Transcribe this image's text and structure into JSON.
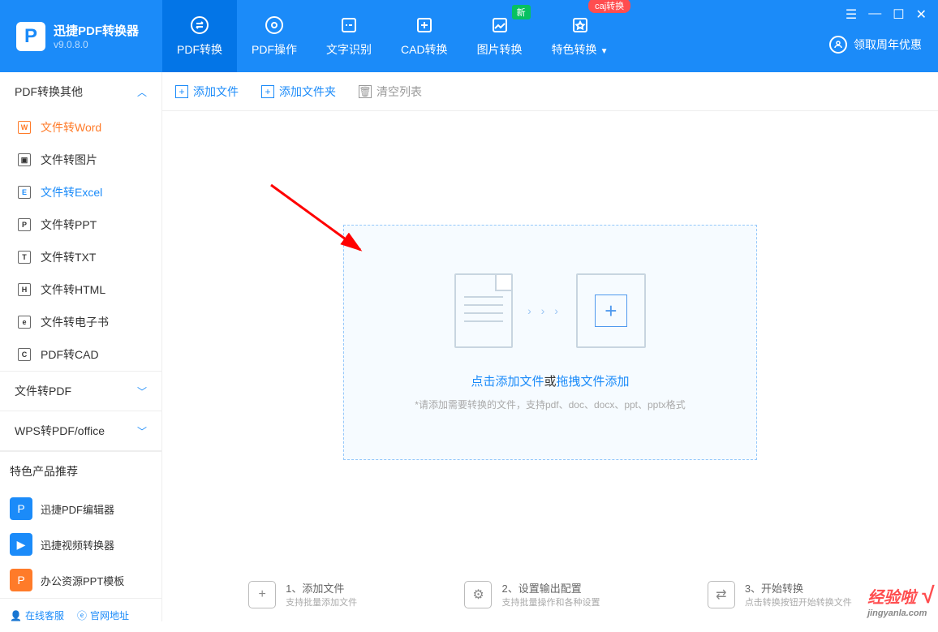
{
  "app": {
    "name": "迅捷PDF转换器",
    "version": "v9.0.8.0"
  },
  "nav": [
    {
      "label": "PDF转换"
    },
    {
      "label": "PDF操作"
    },
    {
      "label": "文字识别"
    },
    {
      "label": "CAD转换"
    },
    {
      "label": "图片转换",
      "badge": "新"
    },
    {
      "label": "特色转换",
      "badge_red": "caj转换"
    }
  ],
  "login": {
    "label": "领取周年优惠"
  },
  "sidebar": {
    "group1": {
      "title": "PDF转换其他",
      "items": [
        {
          "label": "文件转Word",
          "ic": "W"
        },
        {
          "label": "文件转图片",
          "ic": "▣"
        },
        {
          "label": "文件转Excel",
          "ic": "E"
        },
        {
          "label": "文件转PPT",
          "ic": "P"
        },
        {
          "label": "文件转TXT",
          "ic": "T"
        },
        {
          "label": "文件转HTML",
          "ic": "H"
        },
        {
          "label": "文件转电子书",
          "ic": "e"
        },
        {
          "label": "PDF转CAD",
          "ic": "C"
        }
      ]
    },
    "group2": {
      "title": "文件转PDF"
    },
    "group3": {
      "title": "WPS转PDF/office"
    },
    "recommend": {
      "title": "特色产品推荐",
      "items": [
        {
          "label": "迅捷PDF编辑器"
        },
        {
          "label": "迅捷视频转换器"
        },
        {
          "label": "办公资源PPT模板"
        }
      ]
    },
    "footer": {
      "chat": "在线客服",
      "web": "官网地址"
    }
  },
  "toolbar": {
    "add_file": "添加文件",
    "add_folder": "添加文件夹",
    "clear": "清空列表"
  },
  "drop": {
    "link1": "点击添加文件",
    "or": "或",
    "link2": "拖拽文件添加",
    "hint": "*请添加需要转换的文件，支持pdf、doc、docx、ppt、pptx格式"
  },
  "steps": [
    {
      "t1": "1、添加文件",
      "t2": "支持批量添加文件"
    },
    {
      "t1": "2、设置输出配置",
      "t2": "支持批量操作和各种设置"
    },
    {
      "t1": "3、开始转换",
      "t2": "点击转换按钮开始转换文件"
    }
  ],
  "watermark": {
    "text": "经验啦",
    "domain": "jingyanla.com"
  }
}
